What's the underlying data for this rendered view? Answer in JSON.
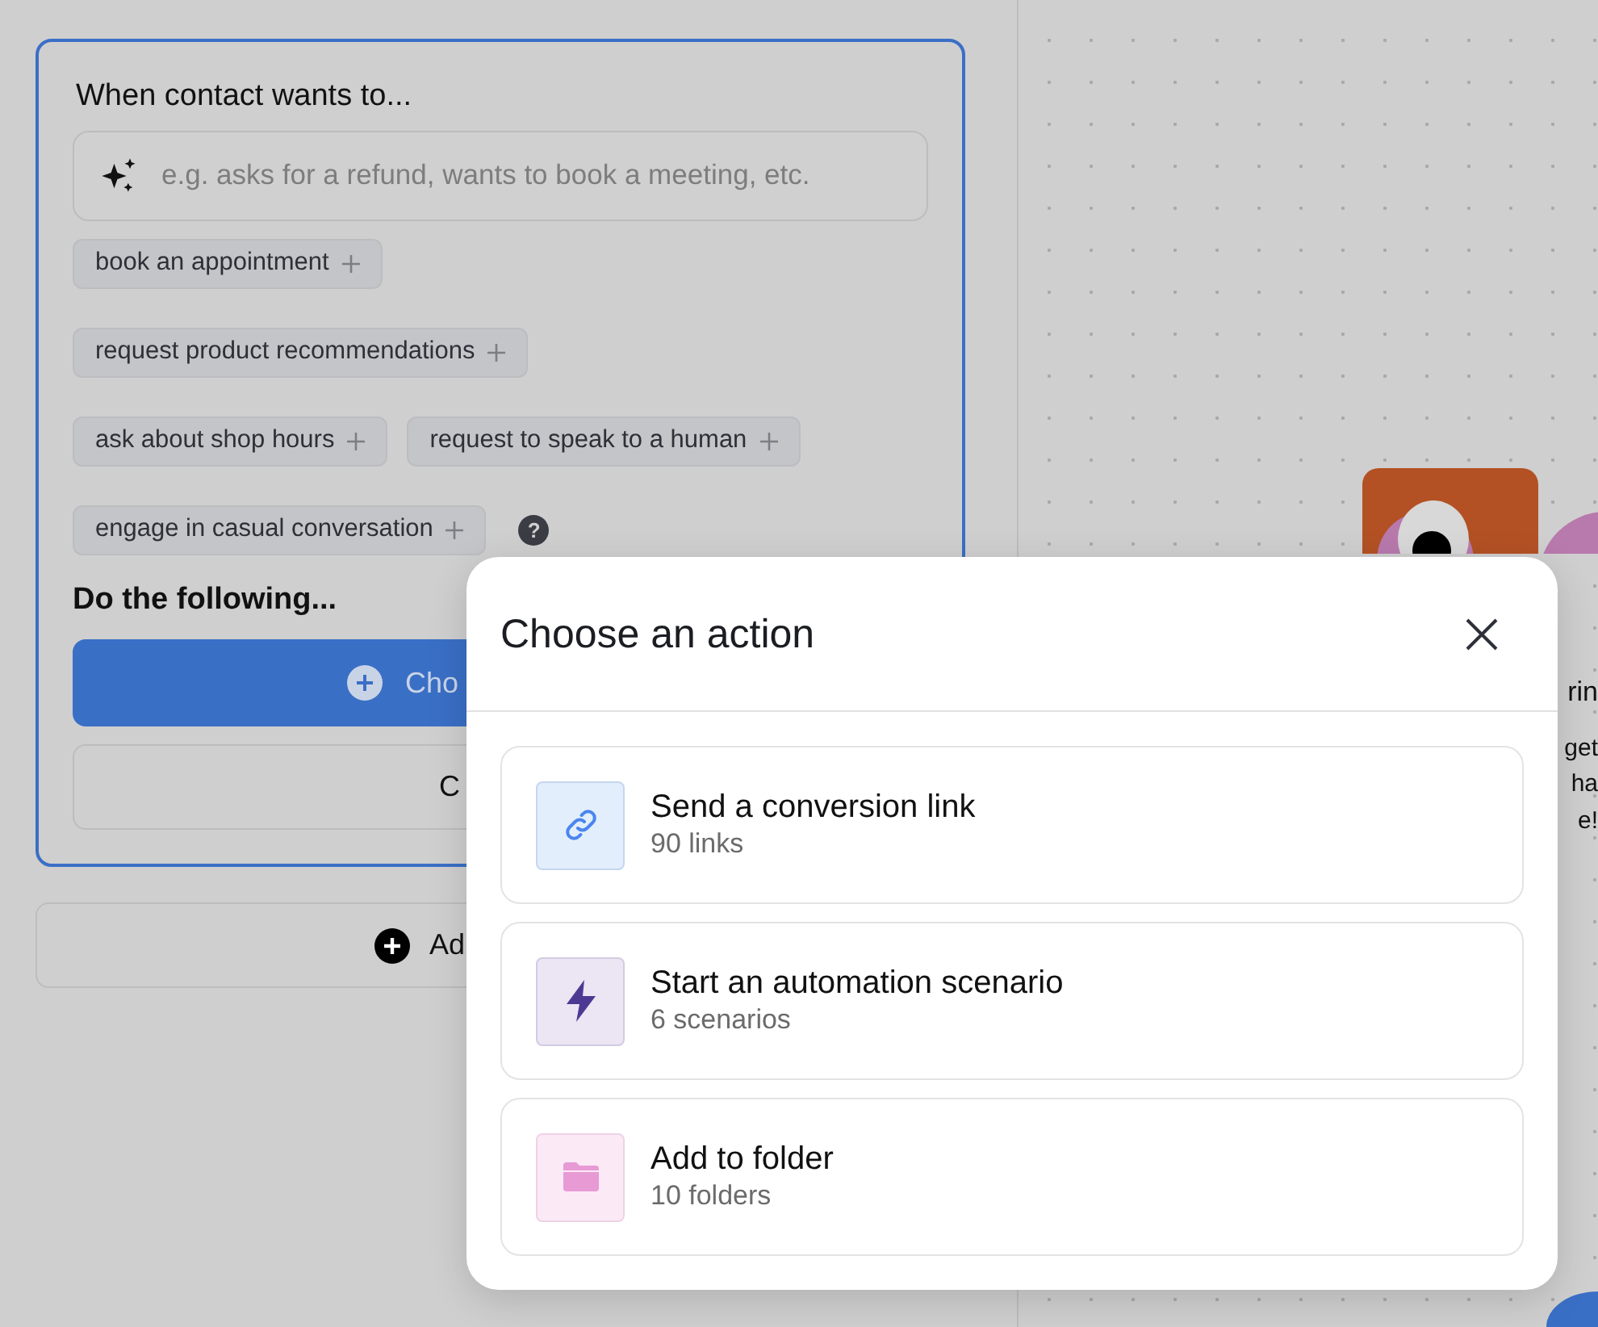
{
  "trigger_card": {
    "title": "When contact wants to...",
    "input": {
      "placeholder": "e.g. asks for a refund, wants to book a meeting, etc."
    },
    "suggestions": [
      "book an appointment",
      "request product recommendations",
      "ask about shop hours",
      "request to speak to a human",
      "engage in casual conversation"
    ],
    "help_label": "?",
    "actions_title": "Do the following...",
    "primary_button": "Cho",
    "secondary_button": "C"
  },
  "add_button": "Ad",
  "canvas": {
    "heading_fragment": "rin",
    "text_fragments": [
      "get",
      "ha",
      "e!"
    ]
  },
  "modal": {
    "title": "Choose an action",
    "options": [
      {
        "kind": "link",
        "title": "Send a conversion link",
        "subtitle": "90 links"
      },
      {
        "kind": "automation",
        "title": "Start an automation scenario",
        "subtitle": "6 scenarios"
      },
      {
        "kind": "folder",
        "title": "Add to folder",
        "subtitle": "10 folders"
      }
    ]
  }
}
